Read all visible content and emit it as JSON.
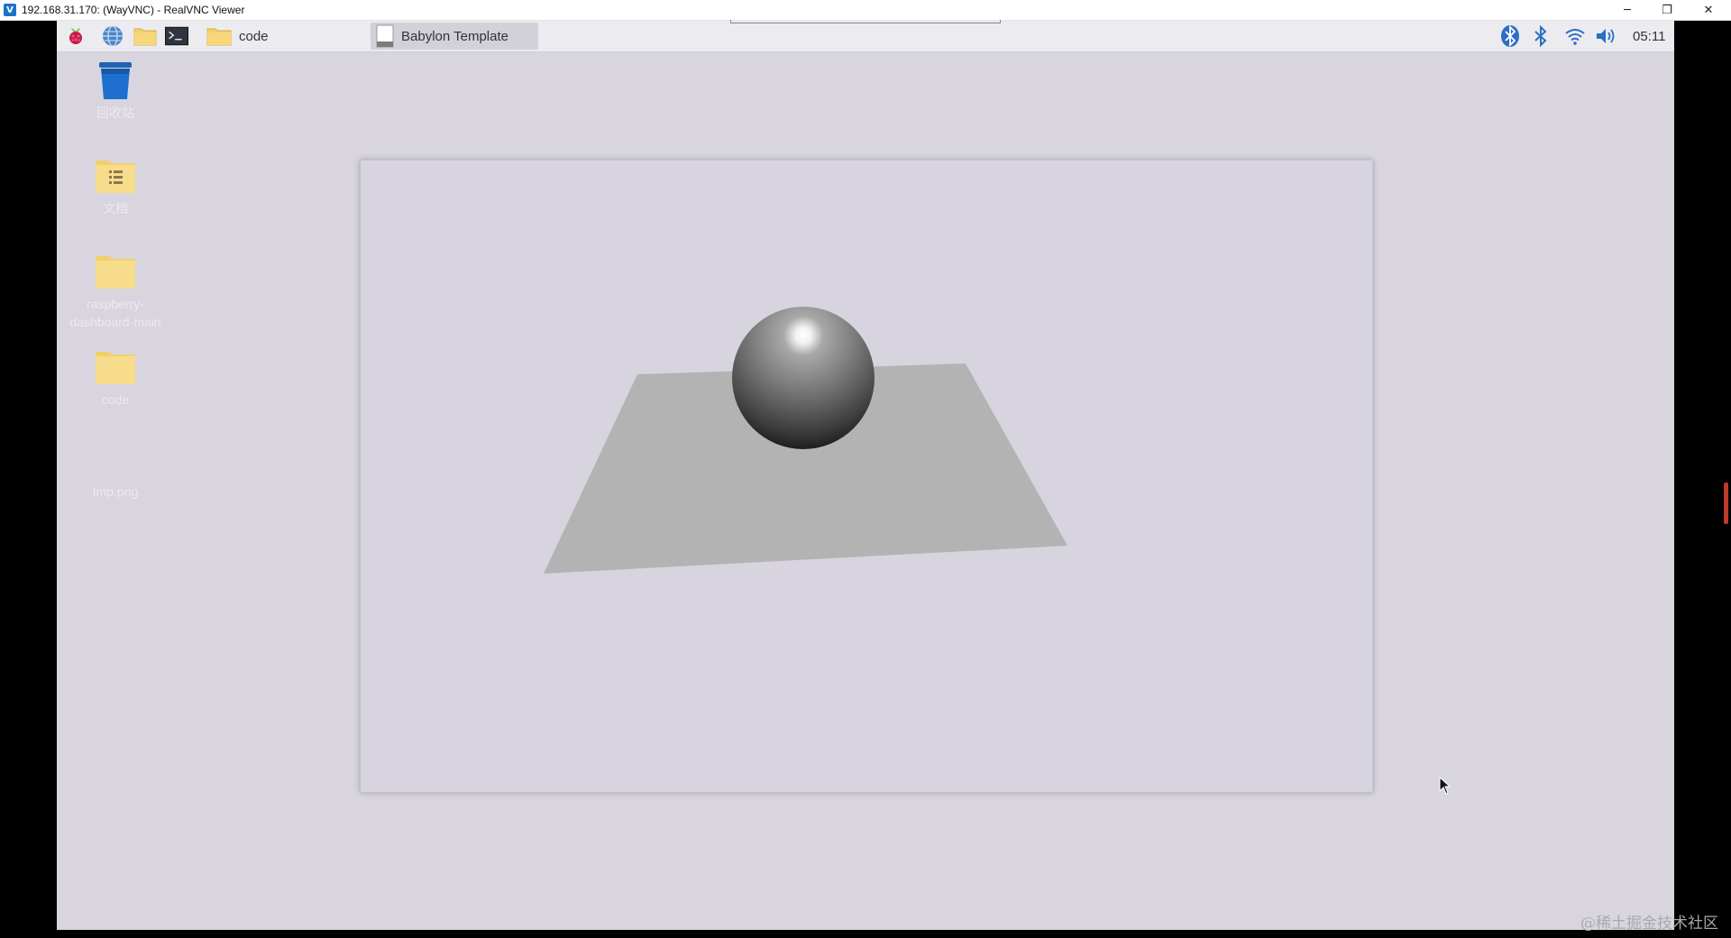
{
  "vnc": {
    "title": "192.168.31.170: (WayVNC) - RealVNC Viewer",
    "app_icon_glyph": "V",
    "controls": {
      "minimize": "─",
      "restore": "❐",
      "close": "✕"
    }
  },
  "taskbar": {
    "launchers": [
      {
        "icon": "raspberry-pi-icon"
      },
      {
        "icon": "globe-icon"
      },
      {
        "icon": "folder-icon"
      },
      {
        "icon": "terminal-icon"
      }
    ],
    "tasks": [
      {
        "label": "code",
        "icon": "folder-icon",
        "active": false
      },
      {
        "label": "Babylon Template",
        "icon": "document-icon",
        "active": true
      }
    ],
    "tray": {
      "icons": [
        "bluetooth-icon",
        "bluetooth-icon",
        "wifi-icon",
        "volume-icon"
      ],
      "clock": "05:11"
    }
  },
  "desktop": {
    "icons": [
      {
        "label": "回收站",
        "icon": "trash-icon"
      },
      {
        "label": "文档",
        "icon": "documents-folder-icon"
      },
      {
        "label": "raspberry-dashboard-main",
        "icon": "folder-icon"
      },
      {
        "label": "code",
        "icon": "folder-icon"
      },
      {
        "label": "tmp.png",
        "icon": "image-file-icon"
      }
    ]
  },
  "babylon": {
    "scene": {
      "objects": [
        "sphere",
        "ground-plane"
      ],
      "background": "#d7d4df",
      "ground_color": "#b3b3b3",
      "sphere_color": "#7a7a7a"
    }
  },
  "watermark": "@稀土掘金技术社区",
  "colors": {
    "desktop_bg": "#d8d5df",
    "taskbar_bg": "#ecebf0",
    "active_task_bg": "#d2d0d9",
    "folder_yellow": "#f7d77a"
  }
}
